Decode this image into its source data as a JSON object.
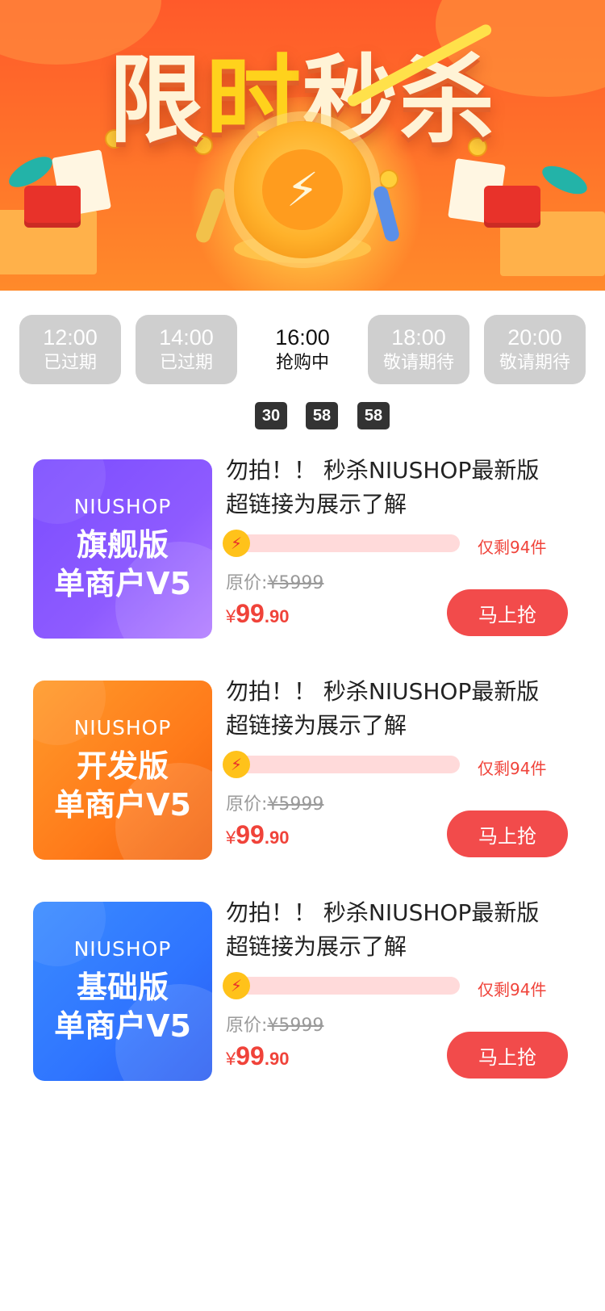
{
  "banner": {
    "title_parts": [
      "限",
      "时",
      "秒杀"
    ]
  },
  "time_tabs": [
    {
      "time": "12:00",
      "status": "已过期",
      "active": false
    },
    {
      "time": "14:00",
      "status": "已过期",
      "active": false
    },
    {
      "time": "16:00",
      "status": "抢购中",
      "active": true
    },
    {
      "time": "18:00",
      "status": "敬请期待",
      "active": false
    },
    {
      "time": "20:00",
      "status": "敬请期待",
      "active": false
    }
  ],
  "countdown": {
    "hours": "30",
    "minutes": "58",
    "seconds": "58"
  },
  "products": [
    {
      "thumb_brand": "NIUSHOP",
      "thumb_edition": "旗舰版",
      "thumb_model": "单商户V5",
      "thumb_color": "#8a55ff",
      "title_line1": "勿拍！！ 秒杀NIUSHOP最新版",
      "title_line2": "超链接为展示了解",
      "remain_text": "仅剩94件",
      "orig_label": "原价:",
      "orig_price": "¥5999",
      "price_currency": "¥",
      "price_int": "99",
      "price_dec": ".90",
      "buy_label": "马上抢"
    },
    {
      "thumb_brand": "NIUSHOP",
      "thumb_edition": "开发版",
      "thumb_model": "单商户V5",
      "thumb_color": "#ff7a1a",
      "title_line1": "勿拍！！ 秒杀NIUSHOP最新版",
      "title_line2": "超链接为展示了解",
      "remain_text": "仅剩94件",
      "orig_label": "原价:",
      "orig_price": "¥5999",
      "price_currency": "¥",
      "price_int": "99",
      "price_dec": ".90",
      "buy_label": "马上抢"
    },
    {
      "thumb_brand": "NIUSHOP",
      "thumb_edition": "基础版",
      "thumb_model": "单商户V5",
      "thumb_color": "#2f74ff",
      "title_line1": "勿拍！！ 秒杀NIUSHOP最新版",
      "title_line2": "超链接为展示了解",
      "remain_text": "仅剩94件",
      "orig_label": "原价:",
      "orig_price": "¥5999",
      "price_currency": "¥",
      "price_int": "99",
      "price_dec": ".90",
      "buy_label": "马上抢"
    }
  ],
  "colors": {
    "accent": "#f24b4b",
    "price": "#f0433a",
    "tab_inactive": "#cfcfcf",
    "countdown_box": "#333333"
  }
}
